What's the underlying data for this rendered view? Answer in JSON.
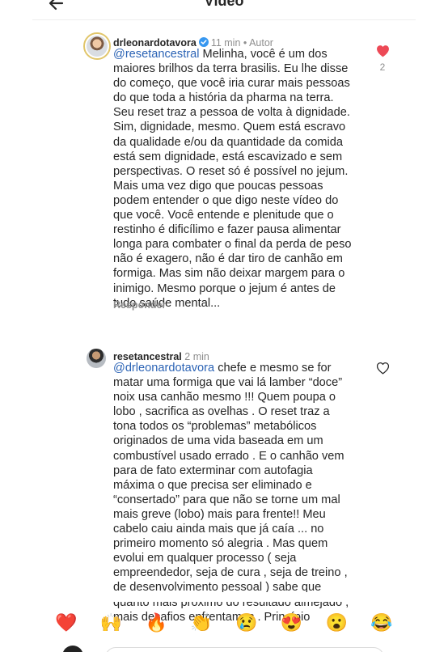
{
  "header": {
    "title": "Vídeo"
  },
  "comments": [
    {
      "username": "drleonardotavora",
      "verified": true,
      "time": "11 min",
      "separator": "•",
      "author_badge": "Autor",
      "mention": "@resetancestral",
      "text": " Melinha, você é um dos maiores brilhos da terra brasilis. Eu lhe disse do começo, que você iria curar mais pessoas do que toda a história da pharma na terra. Seu reset traz a pessoa de volta à dignidade. Sim, dignidade, mesmo. Quem está escravo da qualidade e/ou da quantidade da comida está sem dignidade, está escavizado e sem perspectivas. O reset só é possível no jejum. Mais uma vez digo que poucas pessoas podem entender o que digo neste vídeo do que você. Você entende e plenitude que o restinho é dificílimo e fazer pausa alimentar longa para combater o final da perda de peso não é exagero, não é dar tiro de canhão em formiga. Mas sim não deixar margem para o inimigo. Mesmo porque o jejum é antes de tudo saúde mental...",
      "reply_label": "Responder",
      "like_count": "2",
      "liked": true
    },
    {
      "username": "resetancestral",
      "time": "2 min",
      "mention": "@drleonardotavora",
      "text": " chefe e mesmo se for matar uma formiga que vai lá lamber “doce” noix usa canhão mesmo !!! Quem poupa o lobo , sacrifica as ovelhas . O reset traz a tona todos os “problemas” metabólicos originados de uma vida baseada em um combustível usado errado . E o canhão vem para de fato exterminar com autofagia máxima o que precisa ser eliminado e “consertado” para que não se torne um mal mais greve (lobo) mais para frente!! Meu cabelo caiu ainda mais que já caía ... no primeiro momento só alegria . Mas quem evolui em qualquer processo ( seja empreendedor, seja de cura , seja de treino , de desenvolvimento pessoal ) sabe que quanto mais próximo do resultado almejado , mais desafios enfrentamos . Princípio",
      "liked": false
    }
  ],
  "reactions": [
    {
      "emoji": "❤️",
      "name": "heart-emoji"
    },
    {
      "emoji": "🙌",
      "name": "raised-hands-emoji"
    },
    {
      "emoji": "🔥",
      "name": "fire-emoji"
    },
    {
      "emoji": "👏",
      "name": "clapping-emoji"
    },
    {
      "emoji": "😢",
      "name": "crying-emoji"
    },
    {
      "emoji": "😍",
      "name": "heart-eyes-emoji"
    },
    {
      "emoji": "😮",
      "name": "surprised-emoji"
    },
    {
      "emoji": "😂",
      "name": "laughing-emoji"
    }
  ],
  "colors": {
    "like_red": "#ed4956",
    "mention_blue": "#2b63b5",
    "verified_blue": "#3797f0",
    "muted_gray": "#8e8e8e"
  },
  "icons": {
    "back": "arrow-left-icon",
    "verified": "verified-badge-icon",
    "like": "heart-icon"
  }
}
